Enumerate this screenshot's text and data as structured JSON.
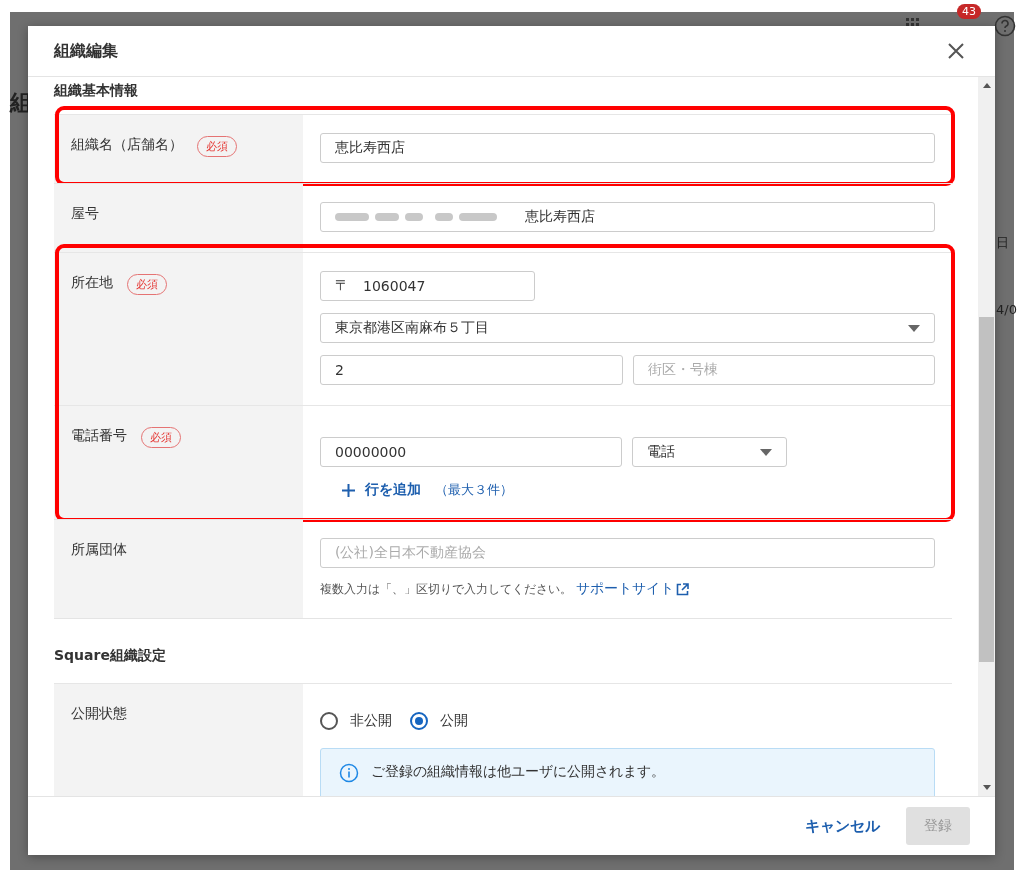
{
  "background": {
    "page_heading": "組",
    "badge": "43",
    "cell_texts": [
      "日",
      "4/0"
    ]
  },
  "dialog": {
    "title": "組織編集"
  },
  "sections": [
    {
      "title": "組織基本情報",
      "blocks": [
        {
          "highlighted": true,
          "rows": [
            {
              "label": "組織名（店舗名）",
              "badge": "必須",
              "kind": "text",
              "value": "恵比寿西店",
              "blurred_prefix": false
            }
          ]
        },
        {
          "highlighted": false,
          "rows": [
            {
              "label": "屋号",
              "kind": "text",
              "value": "恵比寿西店",
              "blurred_prefix": true
            }
          ]
        },
        {
          "highlighted": true,
          "rows": [
            {
              "label": "所在地",
              "badge": "必須",
              "kind": "address",
              "postal_mark": "〒",
              "postal_code": "1060047",
              "prefecture_city": "東京都港区南麻布５丁目",
              "street": "2",
              "building_placeholder": "街区・号棟"
            },
            {
              "label": "電話番号",
              "badge": "必須",
              "kind": "phone",
              "phones": [
                {
                  "number": "00000000",
                  "type": "電話"
                }
              ],
              "add_label": "行を追加",
              "add_note": "（最大３件）"
            }
          ]
        },
        {
          "highlighted": false,
          "rows": [
            {
              "label": "所属団体",
              "kind": "tags",
              "placeholder": "(公社)全日本不動産協会",
              "help": "複数入力は「、」区切りで入力してください。",
              "link": "サポートサイト"
            }
          ]
        }
      ]
    },
    {
      "title": "Square組織設定",
      "blocks": [
        {
          "highlighted": false,
          "rows": [
            {
              "label": "公開状態",
              "kind": "radio",
              "options": [
                {
                  "label": "非公開",
                  "selected": false
                },
                {
                  "label": "公開",
                  "selected": true
                }
              ],
              "info": "ご登録の組織情報は他ユーザに公開されます。"
            }
          ]
        }
      ]
    }
  ],
  "footer": {
    "cancel": "キャンセル",
    "submit": {
      "label": "登録",
      "disabled": true
    }
  }
}
